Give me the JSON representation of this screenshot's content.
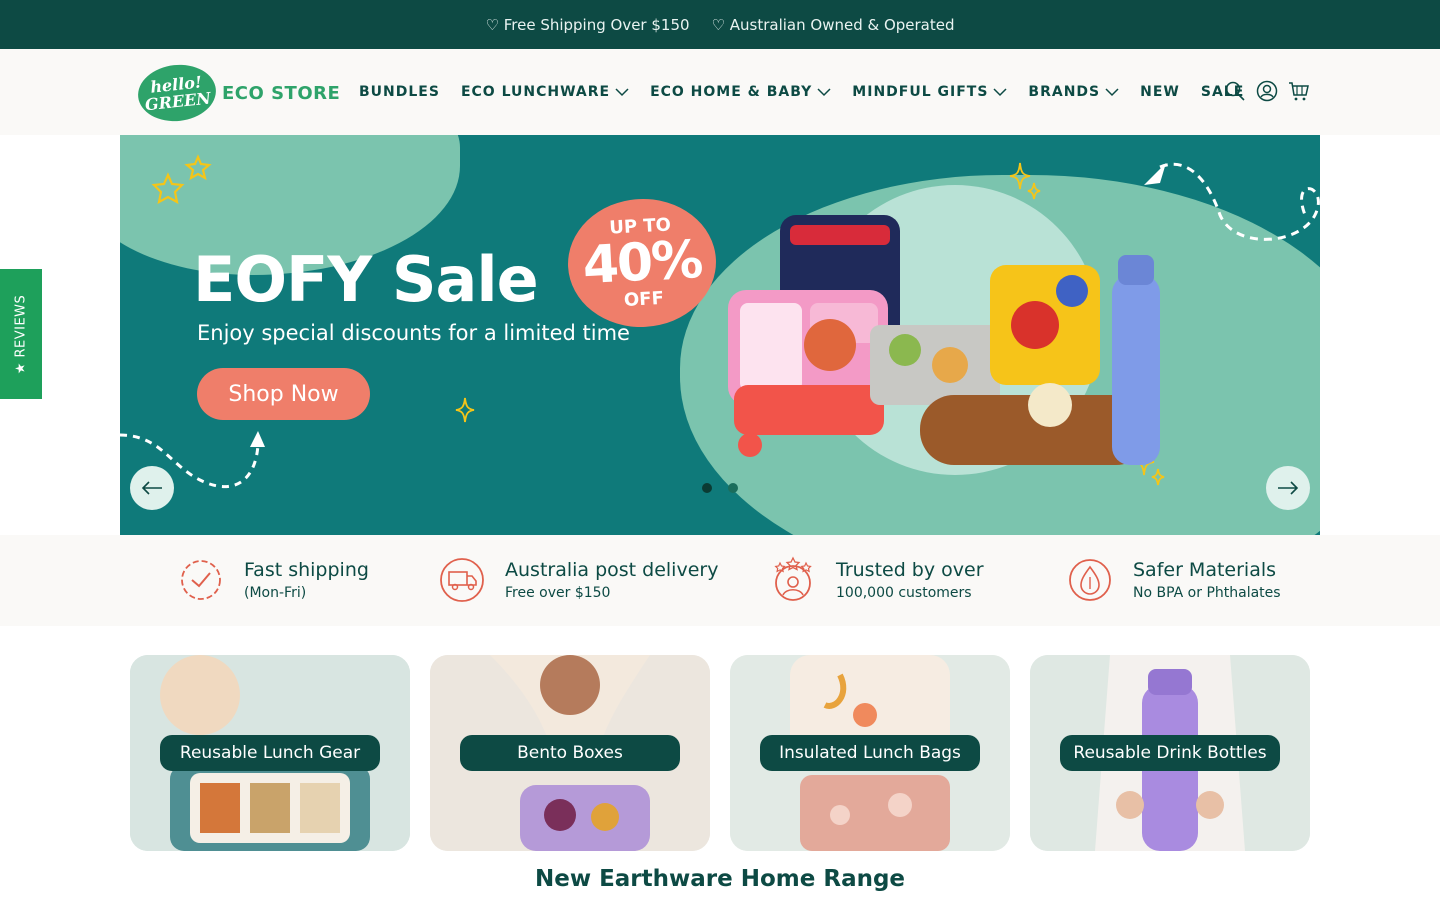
{
  "announcement": {
    "item1": "♡ Free Shipping Over $150",
    "item2": "♡ Australian Owned & Operated"
  },
  "logo": {
    "badge_line1": "hello!",
    "badge_line2": "GREEN",
    "text": "ECO STORE"
  },
  "nav": [
    {
      "label": "BUNDLES",
      "dropdown": false
    },
    {
      "label": "ECO LUNCHWARE",
      "dropdown": true
    },
    {
      "label": "ECO HOME & BABY",
      "dropdown": true
    },
    {
      "label": "MINDFUL GIFTS",
      "dropdown": true
    },
    {
      "label": "BRANDS",
      "dropdown": true
    },
    {
      "label": "NEW",
      "dropdown": false
    },
    {
      "label": "SALE",
      "dropdown": false
    }
  ],
  "header_icons": [
    "search-icon",
    "account-icon",
    "cart-icon"
  ],
  "hero": {
    "title": "EOFY Sale",
    "subtitle": "Enjoy special discounts for a limited time",
    "cta": "Shop Now",
    "badge_top": "UP TO",
    "badge_value": "40%",
    "badge_bottom": "OFF",
    "slides_total": 2,
    "active_slide": 1
  },
  "reviews_tab": "★ REVIEWS",
  "features": [
    {
      "icon": "fast-shipping-icon",
      "title": "Fast shipping",
      "subtitle": "(Mon-Fri)"
    },
    {
      "icon": "free-delivery-truck-icon",
      "title": "Australia post delivery",
      "subtitle": "Free over $150"
    },
    {
      "icon": "trusted-customers-icon",
      "title": "Trusted by over",
      "subtitle": "100,000 customers"
    },
    {
      "icon": "bpa-free-icon",
      "title": "Safer Materials",
      "subtitle": "No BPA or Phthalates"
    }
  ],
  "categories": [
    {
      "label": "Reusable Lunch Gear"
    },
    {
      "label": "Bento Boxes"
    },
    {
      "label": "Insulated Lunch Bags"
    },
    {
      "label": "Reusable Drink Bottles"
    }
  ],
  "section_title": "New Earthware Home Range",
  "colors": {
    "brand_dark": "#0d4a44",
    "brand_green": "#2ea36a",
    "hero_teal": "#0f7a7a",
    "hero_mint": "#7bc4ae",
    "accent_coral": "#ef7e6a",
    "reviews_green": "#1ea05b"
  }
}
